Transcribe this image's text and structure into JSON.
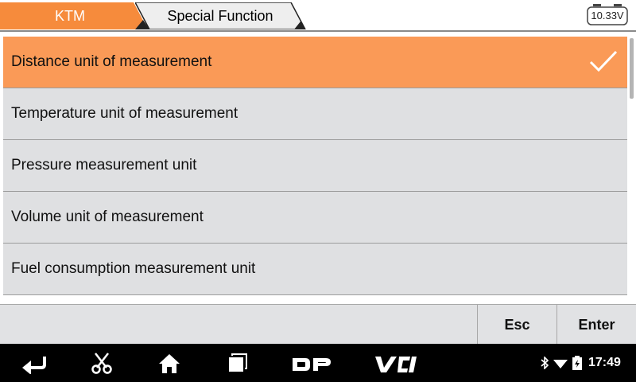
{
  "header": {
    "breadcrumb": [
      "KTM",
      "Special Function"
    ],
    "battery_voltage": "10.33V",
    "accent_color": "#f68b3c"
  },
  "menu": {
    "items": [
      {
        "label": "Distance unit of measurement",
        "selected": true
      },
      {
        "label": "Temperature unit of measurement",
        "selected": false
      },
      {
        "label": "Pressure measurement unit",
        "selected": false
      },
      {
        "label": "Volume unit of measurement",
        "selected": false
      },
      {
        "label": "Fuel consumption measurement unit",
        "selected": false
      }
    ],
    "selected_color": "#fa9a57"
  },
  "actions": {
    "esc_label": "Esc",
    "enter_label": "Enter"
  },
  "system_bar": {
    "icons": [
      "back-icon",
      "scissors-icon",
      "home-icon",
      "recent-apps-icon",
      "dp-icon",
      "vci-icon"
    ],
    "dp_label": "DP",
    "vci_label": "VCI",
    "status_icons": [
      "bluetooth-icon",
      "wifi-icon",
      "battery-icon"
    ],
    "time": "17:49"
  }
}
